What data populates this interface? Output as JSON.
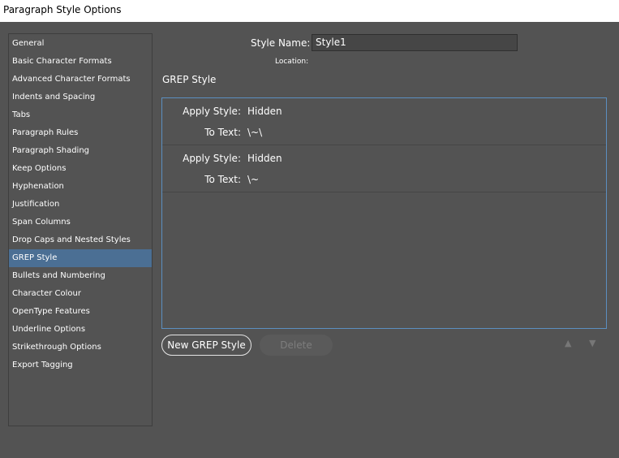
{
  "window": {
    "title": "Paragraph Style Options"
  },
  "sidebar": {
    "items": [
      {
        "label": "General"
      },
      {
        "label": "Basic Character Formats"
      },
      {
        "label": "Advanced Character Formats"
      },
      {
        "label": "Indents and Spacing"
      },
      {
        "label": "Tabs"
      },
      {
        "label": "Paragraph Rules"
      },
      {
        "label": "Paragraph Shading"
      },
      {
        "label": "Keep Options"
      },
      {
        "label": "Hyphenation"
      },
      {
        "label": "Justification"
      },
      {
        "label": "Span Columns"
      },
      {
        "label": "Drop Caps and Nested Styles"
      },
      {
        "label": "GREP Style"
      },
      {
        "label": "Bullets and Numbering"
      },
      {
        "label": "Character Colour"
      },
      {
        "label": "OpenType Features"
      },
      {
        "label": "Underline Options"
      },
      {
        "label": "Strikethrough Options"
      },
      {
        "label": "Export Tagging"
      }
    ],
    "selected": "GREP Style"
  },
  "header": {
    "style_name_label": "Style Name:",
    "style_name_value": "Style1",
    "location_label": "Location:"
  },
  "main": {
    "section_title": "GREP Style",
    "rules": [
      {
        "apply_style_label": "Apply Style:",
        "apply_style_value": "Hidden",
        "to_text_label": "To Text:",
        "to_text_value": "\\~\\"
      },
      {
        "apply_style_label": "Apply Style:",
        "apply_style_value": "Hidden",
        "to_text_label": "To Text:",
        "to_text_value": "\\~"
      }
    ],
    "new_button_label": "New GREP Style",
    "delete_button_label": "Delete",
    "move_up_icon": "▲",
    "move_down_icon": "▼"
  },
  "colors": {
    "background": "#535353",
    "selection": "#4b6f94",
    "focus_border": "#5c8fc0"
  }
}
